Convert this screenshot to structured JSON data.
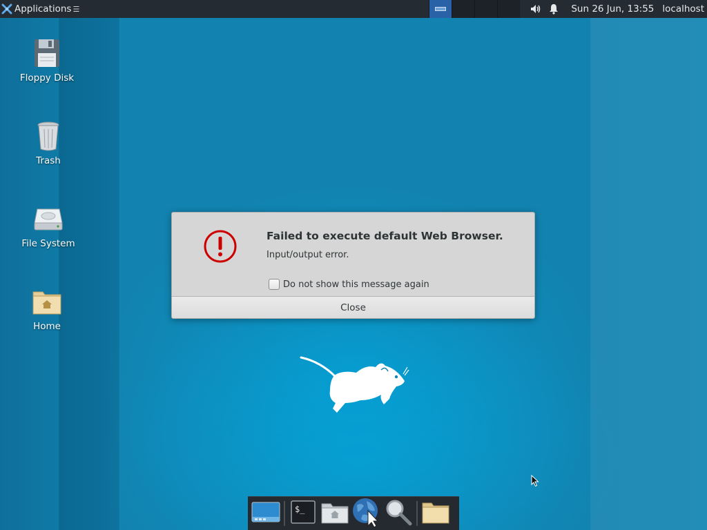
{
  "top_panel": {
    "applications_label": "Applications",
    "clock": "Sun 26 Jun, 13:55",
    "hostname": "localhost",
    "workspaces": 4,
    "active_workspace": 1
  },
  "desktop": {
    "icons": [
      {
        "label": "Floppy Disk",
        "icon": "floppy-disk-icon"
      },
      {
        "label": "Trash",
        "icon": "trash-icon"
      },
      {
        "label": "File System",
        "icon": "hard-drive-icon"
      },
      {
        "label": "Home",
        "icon": "home-folder-icon"
      }
    ]
  },
  "dialog": {
    "title": "Failed to execute default Web Browser.",
    "message": "Input/output error.",
    "checkbox_label": "Do not show this message again",
    "checkbox_checked": false,
    "close_label": "Close",
    "icon": "error-icon",
    "accent_color": "#cc0000"
  },
  "dock": {
    "items": [
      {
        "name": "show-desktop",
        "icon": "show-desktop-icon"
      },
      {
        "name": "terminal",
        "icon": "terminal-icon"
      },
      {
        "name": "file-manager",
        "icon": "home-folder-icon"
      },
      {
        "name": "web-browser",
        "icon": "web-browser-icon"
      },
      {
        "name": "app-finder",
        "icon": "magnifier-icon"
      },
      {
        "name": "folder",
        "icon": "folder-icon"
      }
    ]
  },
  "colors": {
    "panel_bg": "#242b33",
    "desktop_bg": "#1283b0",
    "active_workspace": "#2a62a8"
  }
}
